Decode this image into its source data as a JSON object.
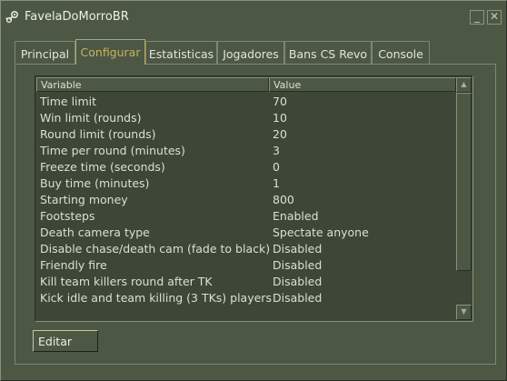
{
  "window": {
    "title": "FavelaDoMorroBR",
    "minimize_symbol": "_",
    "close_symbol": "✕"
  },
  "tabs": [
    {
      "label": "Principal",
      "active": false
    },
    {
      "label": "Configurar",
      "active": true
    },
    {
      "label": "Estatisticas",
      "active": false
    },
    {
      "label": "Jogadores",
      "active": false
    },
    {
      "label": "Bans CS Revo",
      "active": false
    },
    {
      "label": "Console",
      "active": false
    }
  ],
  "table": {
    "columns": [
      "Variable",
      "Value"
    ],
    "rows": [
      {
        "variable": "Time limit",
        "value": "70"
      },
      {
        "variable": "Win limit (rounds)",
        "value": "10"
      },
      {
        "variable": "Round limit (rounds)",
        "value": "20"
      },
      {
        "variable": "Time per round (minutes)",
        "value": "3"
      },
      {
        "variable": "Freeze time (seconds)",
        "value": "0"
      },
      {
        "variable": "Buy time (minutes)",
        "value": "1"
      },
      {
        "variable": "Starting money",
        "value": "800"
      },
      {
        "variable": "Footsteps",
        "value": "Enabled"
      },
      {
        "variable": "Death camera type",
        "value": "Spectate anyone"
      },
      {
        "variable": "Disable chase/death cam (fade to black)",
        "value": "Disabled"
      },
      {
        "variable": "Friendly fire",
        "value": "Disabled"
      },
      {
        "variable": "Kill team killers round after TK",
        "value": "Disabled"
      },
      {
        "variable": "Kick idle and team killing (3 TKs) players",
        "value": "Disabled"
      }
    ]
  },
  "scrollbar": {
    "up_symbol": "▲",
    "down_symbol": "▼"
  },
  "buttons": {
    "edit_label": "Editar"
  },
  "icons": {
    "app": "steam-logo-icon"
  },
  "colors": {
    "background": "#4c5844",
    "list_background": "#3e4637",
    "active_tab": "#c9b062",
    "text": "#dedfd6"
  }
}
